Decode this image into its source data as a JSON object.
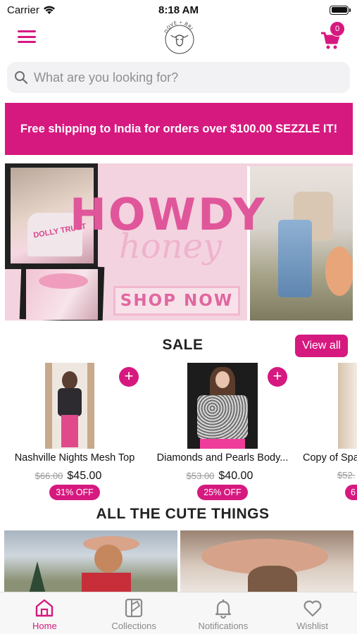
{
  "status_bar": {
    "carrier": "Carrier",
    "time": "8:18 AM"
  },
  "header": {
    "logo_text": "DOVE • BRI",
    "cart_count": "0"
  },
  "search": {
    "placeholder": "What are you looking for?"
  },
  "promo": {
    "text": "Free shipping to India for orders over $100.00 SEZZLE IT!"
  },
  "hero": {
    "title": "HOWDY",
    "subtitle": "honey",
    "cta": "SHOP NOW",
    "shirt_text": "DOLLY TRUST"
  },
  "sale": {
    "title": "SALE",
    "view_all": "View all",
    "products": [
      {
        "name": "Nashville Nights Mesh Top",
        "old_price": "$66.00",
        "price": "$45.00",
        "discount": "31% OFF"
      },
      {
        "name": "Diamonds and Pearls Body...",
        "old_price": "$53.00",
        "price": "$40.00",
        "discount": "25% OFF"
      },
      {
        "name": "Copy of Spa",
        "old_price": "$52.",
        "price": "",
        "discount": "6"
      }
    ]
  },
  "collections": {
    "title": "ALL THE CUTE THINGS"
  },
  "tab_bar": {
    "tabs": [
      {
        "label": "Home",
        "icon": "home-icon",
        "active": true
      },
      {
        "label": "Collections",
        "icon": "collections-icon",
        "active": false
      },
      {
        "label": "Notifications",
        "icon": "bell-icon",
        "active": false
      },
      {
        "label": "Wishlist",
        "icon": "heart-icon",
        "active": false
      }
    ]
  },
  "colors": {
    "accent": "#d6197f",
    "inactive_tab": "#8a8a8a",
    "search_bg": "#f2f2f4"
  }
}
